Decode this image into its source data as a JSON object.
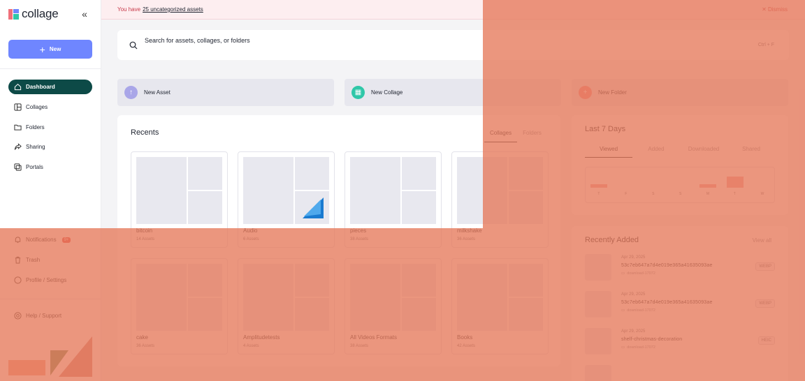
{
  "app": {
    "logo_text": "collage",
    "brand_color": "#6f86ff"
  },
  "sidebar": {
    "new_label": "New",
    "nav": [
      {
        "label": "Dashboard",
        "icon": "home-icon"
      },
      {
        "label": "Collages",
        "icon": "collage-icon"
      },
      {
        "label": "Folders",
        "icon": "folder-icon"
      },
      {
        "label": "Sharing",
        "icon": "share-icon"
      },
      {
        "label": "Portals",
        "icon": "portal-icon"
      }
    ],
    "bottom": [
      {
        "label": "Notifications",
        "badge": "9+",
        "icon": "bell-icon"
      },
      {
        "label": "Trash",
        "icon": "trash-icon"
      },
      {
        "label": "Profile / Settings",
        "icon": "profile-icon"
      },
      {
        "label": "Help / Support",
        "icon": "help-icon"
      }
    ]
  },
  "banner": {
    "prefix": "You have",
    "link": "25 uncategorized assets",
    "dismiss": "Dismiss"
  },
  "search": {
    "placeholder": "Search for assets, collages, or folders",
    "shortcut": "Ctrl + F"
  },
  "quick_actions": [
    {
      "label": "New Asset",
      "color": "#a9a6e8",
      "icon": "upload-icon"
    },
    {
      "label": "New Collage",
      "color": "#2fc7a8",
      "icon": "collage-icon"
    },
    {
      "label": "New Folder",
      "color": "#f28b8b",
      "icon": "folder-plus-icon"
    }
  ],
  "recents": {
    "title": "Recents",
    "tabs": [
      "Collages",
      "Folders"
    ],
    "cards": [
      {
        "name": "bitcoin",
        "count": "14 Assets"
      },
      {
        "name": "Audio",
        "count": "6 Assets"
      },
      {
        "name": "pieces",
        "count": "38 Assets"
      },
      {
        "name": "milkshake",
        "count": "36 Assets"
      },
      {
        "name": "cake",
        "count": "36 Assets"
      },
      {
        "name": "Amplitudetests",
        "count": "4 Assets"
      },
      {
        "name": "All Videos Formats",
        "count": "38 Assets"
      },
      {
        "name": "Books",
        "count": "42 Assets"
      }
    ]
  },
  "last7": {
    "title": "Last 7 Days",
    "tabs": [
      "Viewed",
      "Added",
      "Downloaded",
      "Shared"
    ],
    "days": [
      "T",
      "F",
      "S",
      "S",
      "M",
      "T",
      "W"
    ],
    "viewed_relative": [
      0.25,
      0,
      0,
      0,
      0.15,
      1,
      0
    ]
  },
  "recently_added": {
    "title": "Recently Added",
    "view_all": "View all",
    "items": [
      {
        "date": "Apr 29, 2025",
        "name": "53c7eb647a7d4e019e365a41635093ae",
        "folder": "download-17072",
        "tag": "WEBP"
      },
      {
        "date": "Apr 29, 2025",
        "name": "53c7eb647a7d4e019e365a41635093ae",
        "folder": "download-17072",
        "tag": "WEBP"
      },
      {
        "date": "Apr 29, 2025",
        "name": "shelf-christmas-decoration",
        "folder": "download-17072",
        "tag": "HEIC"
      }
    ]
  }
}
